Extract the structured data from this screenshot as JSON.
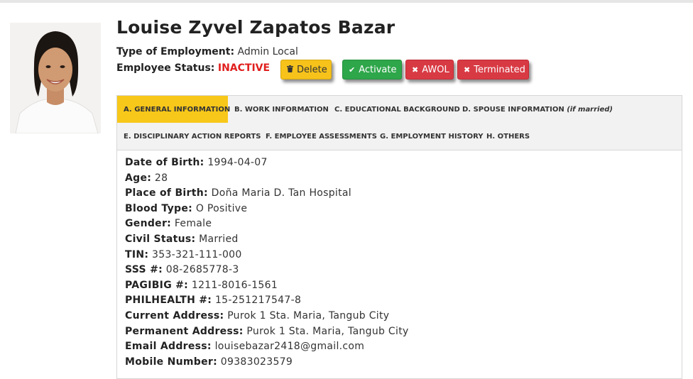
{
  "employee": {
    "name": "Louise Zyvel Zapatos Bazar",
    "employment_label": "Type of Employment:",
    "employment_value": "Admin Local",
    "status_label": "Employee Status:",
    "status_value": "INACTIVE"
  },
  "actions": {
    "delete": "Delete",
    "activate": "Activate",
    "awol": "AWOL",
    "terminated": "Terminated"
  },
  "tabs": [
    "A. GENERAL INFORMATION",
    "B. WORK INFORMATION",
    "C. EDUCATIONAL BACKGROUND",
    "D. SPOUSE INFORMATION",
    "E. DISCIPLINARY ACTION REPORTS",
    "F. EMPLOYEE ASSESSMENTS",
    "G. EMPLOYMENT HISTORY",
    "H. OTHERS"
  ],
  "tab_d_note": "(if married)",
  "active_tab": "A. GENERAL INFORMATION",
  "general_info": [
    {
      "label": "Date of Birth:",
      "value": "1994-04-07"
    },
    {
      "label": "Age:",
      "value": "28"
    },
    {
      "label": "Place of Birth:",
      "value": "Doña Maria D. Tan Hospital"
    },
    {
      "label": "Blood Type:",
      "value": "O Positive"
    },
    {
      "label": "Gender:",
      "value": "Female"
    },
    {
      "label": "Civil Status:",
      "value": "Married"
    },
    {
      "label": "TIN:",
      "value": "353-321-111-000"
    },
    {
      "label": "SSS #:",
      "value": "08-2685778-3"
    },
    {
      "label": "PAGIBIG #:",
      "value": "1211-8016-1561"
    },
    {
      "label": "PHILHEALTH #:",
      "value": "15-251217547-8"
    },
    {
      "label": "Current Address:",
      "value": "Purok 1 Sta. Maria, Tangub City"
    },
    {
      "label": "Permanent Address:",
      "value": "Purok 1 Sta. Maria, Tangub City"
    },
    {
      "label": "Email Address:",
      "value": "louisebazar2418@gmail.com"
    },
    {
      "label": "Mobile Number:",
      "value": "09383023579"
    }
  ],
  "icons": {
    "delete": "trash-icon",
    "activate": "check-icon",
    "awol": "x-icon",
    "terminated": "x-icon"
  },
  "colors": {
    "status_inactive": "#e0201e",
    "active_tab": "#f7c81a",
    "delete_btn": "#f7c31b",
    "activate_btn": "#2ea64a",
    "danger_btn": "#d83a44"
  }
}
